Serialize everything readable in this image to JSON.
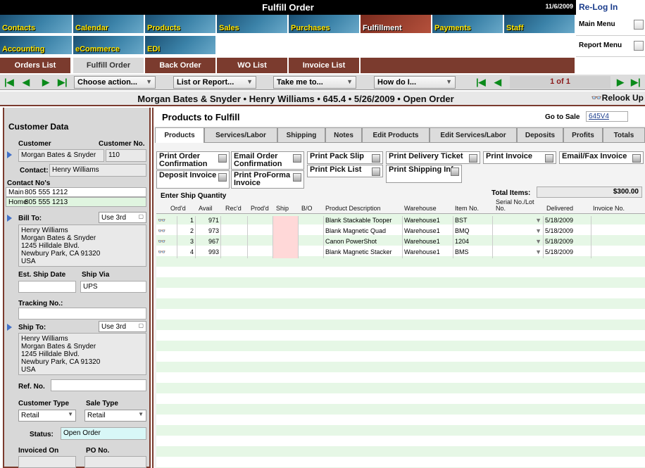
{
  "window": {
    "title": "Fulfill Order",
    "date": "11/6/2009",
    "relogin": "Re-Log In"
  },
  "modules": {
    "row1": [
      "Contacts",
      "Calendar",
      "Products",
      "Sales",
      "Purchases",
      "Fulfillment",
      "Payments",
      "Staff"
    ],
    "row2": [
      "Accounting",
      "eCommerce",
      "EDI"
    ],
    "selected": "Fulfillment"
  },
  "side_menu": {
    "main": "Main Menu",
    "report": "Report Menu"
  },
  "nav_tabs": [
    "Orders List",
    "Fulfill Order",
    "Back Order",
    "WO List",
    "Invoice List"
  ],
  "toolbar": {
    "choose_action": "Choose action...",
    "list_report": "List or Report...",
    "take_me": "Take me to...",
    "how_do": "How do I...",
    "pager": "1 of 1"
  },
  "header": {
    "summary": "Morgan Bates & Snyder  •  Henry Williams  •  645.4  •  5/26/2009  •  Open Order",
    "relook": "Relook Up"
  },
  "customer": {
    "section": "Customer Data",
    "customer_label": "Customer",
    "customer_no_label": "Customer No.",
    "customer": "Morgan Bates & Snyder",
    "customer_no": "110",
    "contact_label": "Contact:",
    "contact": "Henry Williams",
    "contact_nos_label": "Contact No's",
    "phones": [
      {
        "type": "Main",
        "number": "805 555 1212"
      },
      {
        "type": "Home",
        "number": "805 555 1213"
      }
    ],
    "bill_to_label": "Bill To:",
    "use3rd": "Use 3rd",
    "bill_to": [
      "Henry Williams",
      "Morgan Bates & Snyder",
      "1245 Hilldale Blvd.",
      "Newbury Park, CA 91320",
      "USA"
    ],
    "est_ship_label": "Est. Ship Date",
    "ship_via_label": "Ship Via",
    "ship_via": "UPS",
    "tracking_label": "Tracking No.:",
    "ship_to_label": "Ship To:",
    "ship_to": [
      "Henry Williams",
      "Morgan Bates & Snyder",
      "1245 Hilldale Blvd.",
      "Newbury Park, CA 91320",
      "USA"
    ],
    "ref_label": "Ref. No.",
    "cust_type_label": "Customer Type",
    "cust_type": "Retail",
    "sale_type_label": "Sale Type",
    "sale_type": "Retail",
    "status_label": "Status:",
    "status": "Open Order",
    "invoiced_label": "Invoiced On",
    "po_label": "PO No."
  },
  "products": {
    "title": "Products to Fulfill",
    "go_to_sale_label": "Go to Sale",
    "go_to_sale": "645V4",
    "tabs": [
      "Products",
      "Services/Labor",
      "Shipping",
      "Notes",
      "Edit Products",
      "Edit Services/Labor",
      "Deposits",
      "Profits",
      "Totals"
    ],
    "print_buttons": [
      "Print Order Confirmation",
      "Email Order Confirmation",
      "Print Pack Slip",
      "Print Delivery Ticket",
      "Print Invoice",
      "Email/Fax Invoice",
      "Deposit Invoice",
      "Print ProForma Invoice",
      "Print Pick List",
      "Print Shipping Info"
    ],
    "enter_label": "Enter  Ship Quantity",
    "total_items_label": "Total Items:",
    "total_items": "$300.00",
    "columns": [
      "Ord'd",
      "Avail",
      "Rec'd",
      "Prod'd",
      "Ship",
      "B/O",
      "Product Description",
      "Warehouse",
      "Item No.",
      "Serial No./Lot No.",
      "Delivered",
      "Invoice No."
    ],
    "rows": [
      {
        "ordd": "1",
        "avail": "971",
        "desc": "Blank Stackable Tooper",
        "wh": "Warehouse1",
        "item": "BST",
        "delivered": "5/18/2009"
      },
      {
        "ordd": "2",
        "avail": "973",
        "desc": "Blank Magnetic Quad",
        "wh": "Warehouse1",
        "item": "BMQ",
        "delivered": "5/18/2009"
      },
      {
        "ordd": "3",
        "avail": "967",
        "desc": "Canon PowerShot",
        "wh": "Warehouse1",
        "item": "1204",
        "delivered": "5/18/2009"
      },
      {
        "ordd": "4",
        "avail": "993",
        "desc": "Blank Magnetic Stacker",
        "wh": "Warehouse1",
        "item": "BMS",
        "delivered": "5/18/2009"
      }
    ]
  }
}
